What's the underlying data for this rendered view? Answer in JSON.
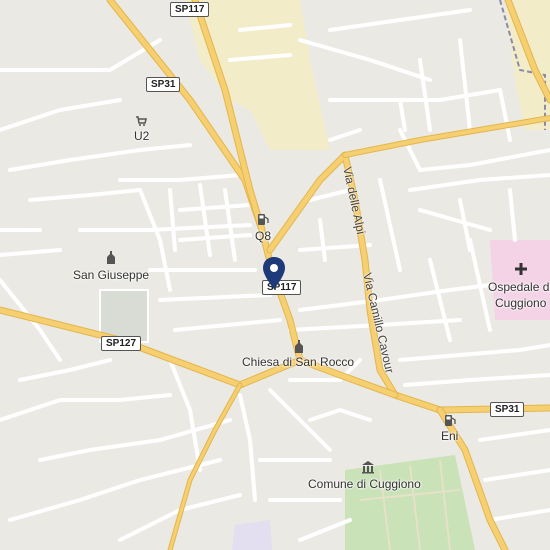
{
  "map": {
    "colors": {
      "background": "#ebe9e3",
      "road_minor": "#ffffff",
      "road_major": "#f6cf71",
      "road_major_edge": "#e2b64e",
      "industrial": "#f2ecc9",
      "hospital": "#f4d3e6",
      "park": "#c9e2b8",
      "cemetery": "#d8dcd4",
      "boundary": "#8a8aa8",
      "pin": "#1f3a7a"
    },
    "places": {
      "u2": "U2",
      "san_giuseppe": "San Giuseppe",
      "q8": "Q8",
      "chiesa": "Chiesa di San Rocco",
      "ospedale_line1": "Ospedale di",
      "ospedale_line2": "Cuggiono",
      "eni": "Eni",
      "comune": "Comune di Cuggiono"
    },
    "roads": {
      "sp117_top": "SP117",
      "sp117_mid": "SP117",
      "sp31_left": "SP31",
      "sp31_right": "SP31",
      "sp127": "SP127",
      "via_alpi": "Via delle Alpi",
      "via_cavour": "Via Camillo Cavour"
    },
    "icons": {
      "fuel": "fuel-icon",
      "shop": "shopping-cart-icon",
      "religious": "church-icon",
      "hospital": "hospital-cross-icon",
      "townhall": "town-hall-icon",
      "marker": "location-pin-icon"
    }
  }
}
